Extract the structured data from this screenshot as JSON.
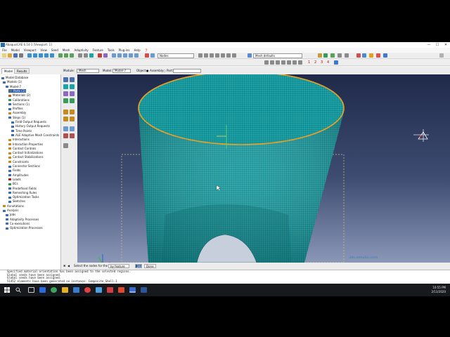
{
  "window": {
    "title": "Abaqus/CAE 6.14-1 [Viewport: 1]",
    "minimize": "—",
    "maximize": "☐",
    "close": "✕"
  },
  "menu": [
    "File",
    "Model",
    "Viewport",
    "View",
    "Seed",
    "Mesh",
    "Adaptivity",
    "Feature",
    "Tools",
    "Plug-ins",
    "Help",
    "❓"
  ],
  "toolbar": {
    "selection_filter": "Nodes",
    "mesh_defaults": "Mesh defaults",
    "viewport_numbers": [
      "1",
      "2",
      "3",
      "4"
    ]
  },
  "tabs": {
    "model": "Model",
    "results": "Results"
  },
  "context": {
    "module_label": "Module:",
    "module_value": "Mesh",
    "model_label": "Model:",
    "model_value": "Model-7",
    "object_label": "Object:",
    "assembly_label": "Assembly",
    "part_label": "Part:",
    "part_value": ""
  },
  "tree": {
    "items": [
      {
        "label": "Model Database",
        "icon_color": "#3a6fb0"
      },
      {
        "label": "Models (1)",
        "icon_color": "#3a6fb0"
      },
      {
        "label": "Model-7",
        "icon_color": "#3a6fb0"
      },
      {
        "label": "Parts (1)",
        "icon_color": "#6d6d6d",
        "highlighted": true
      },
      {
        "label": "Materials (2)",
        "icon_color": "#c25a2c"
      },
      {
        "label": "Calibrations",
        "icon_color": "#2f9a4a"
      },
      {
        "label": "Sections (1)",
        "icon_color": "#3a6fb0"
      },
      {
        "label": "Profiles",
        "icon_color": "#3a6fb0"
      },
      {
        "label": "Assembly",
        "icon_color": "#c58b20"
      },
      {
        "label": "Steps (1)",
        "icon_color": "#3a6fb0"
      },
      {
        "label": "Field Output Requests",
        "icon_color": "#3a6fb0"
      },
      {
        "label": "History Output Requests",
        "icon_color": "#3a6fb0"
      },
      {
        "label": "Time Points",
        "icon_color": "#3a6fb0"
      },
      {
        "label": "ALE Adaptive Mesh Constraints",
        "icon_color": "#3a6fb0"
      },
      {
        "label": "Interactions",
        "icon_color": "#c58b20"
      },
      {
        "label": "Interaction Properties",
        "icon_color": "#c58b20"
      },
      {
        "label": "Contact Controls",
        "icon_color": "#c58b20"
      },
      {
        "label": "Contact Initializations",
        "icon_color": "#c58b20"
      },
      {
        "label": "Contact Stabilizations",
        "icon_color": "#c58b20"
      },
      {
        "label": "Constraints",
        "icon_color": "#c58b20"
      },
      {
        "label": "Connector Sections",
        "icon_color": "#3a6fb0"
      },
      {
        "label": "Fields",
        "icon_color": "#3a6fb0"
      },
      {
        "label": "Amplitudes",
        "icon_color": "#3a6fb0"
      },
      {
        "label": "Loads",
        "icon_color": "#b02020"
      },
      {
        "label": "BCs",
        "icon_color": "#2f9a4a"
      },
      {
        "label": "Predefined Fields",
        "icon_color": "#3a6fb0"
      },
      {
        "label": "Remeshing Rules",
        "icon_color": "#3a6fb0"
      },
      {
        "label": "Optimization Tasks",
        "icon_color": "#3a6fb0"
      },
      {
        "label": "Sketches",
        "icon_color": "#3a6fb0"
      },
      {
        "label": "Annotations",
        "icon_color": "#c58b20"
      },
      {
        "label": "Analysis",
        "icon_color": "#3a6fb0"
      },
      {
        "label": "Jobs",
        "icon_color": "#3a6fb0"
      },
      {
        "label": "Adaptivity Processes",
        "icon_color": "#3a6fb0"
      },
      {
        "label": "Co-executions",
        "icon_color": "#3a6fb0"
      },
      {
        "label": "Optimization Processes",
        "icon_color": "#3a6fb0"
      }
    ]
  },
  "prompt": {
    "text": "Select the nodes for the set",
    "method": "by feature edge",
    "angle": "20.0",
    "done": "Done"
  },
  "messages": [
    "Specified material orientation has been assigned to the selected regions.",
    "Global seeds have been assigned.",
    "Global seeds have been assigned.",
    "51452 elements have been generated on instance: Composite_Shell-1"
  ],
  "watermark": "3ds.simulia.com",
  "clock": {
    "time": "10:55 PM",
    "date": "2/13/2020"
  },
  "colors": {
    "mesh": "#1ba3a8",
    "mesh_line": "#0b5a5e",
    "edge_highlight": "#f0a020",
    "viewport_top": "#1f2a4a",
    "viewport_bottom": "#8a97b7"
  }
}
